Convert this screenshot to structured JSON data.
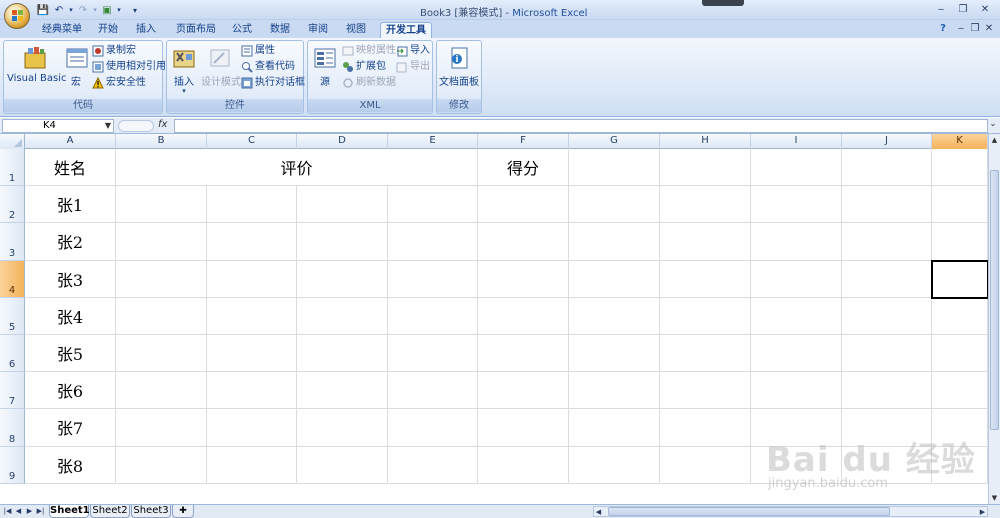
{
  "window": {
    "title_doc": "Book3 [兼容模式]",
    "title_sep": " - ",
    "title_app": "Microsoft Excel"
  },
  "tabs": [
    {
      "label": "经典菜单"
    },
    {
      "label": "开始"
    },
    {
      "label": "插入"
    },
    {
      "label": "页面布局"
    },
    {
      "label": "公式"
    },
    {
      "label": "数据"
    },
    {
      "label": "审阅"
    },
    {
      "label": "视图"
    },
    {
      "label": "开发工具",
      "active": true
    }
  ],
  "ribbon": {
    "code": {
      "label": "代码",
      "visual_basic": "Visual Basic",
      "macros": "宏",
      "record_macro": "录制宏",
      "relative_ref": "使用相对引用",
      "macro_security": "宏安全性"
    },
    "controls": {
      "label": "控件",
      "insert": "插入",
      "design_mode": "设计模式",
      "properties": "属性",
      "view_code": "查看代码",
      "run_dialog": "执行对话框"
    },
    "xml": {
      "label": "XML",
      "source": "源",
      "map_properties": "映射属性",
      "expansion_packs": "扩展包",
      "refresh_data": "刷新数据",
      "import": "导入",
      "export": "导出"
    },
    "modify": {
      "label": "修改",
      "document_panel": "文档面板"
    }
  },
  "formula_bar": {
    "name_box": "K4",
    "fx": "fx",
    "value": ""
  },
  "sheet": {
    "columns": [
      "A",
      "B",
      "C",
      "D",
      "E",
      "F",
      "G",
      "H",
      "I",
      "J",
      "K"
    ],
    "selected_column": "K",
    "rows": [
      "1",
      "2",
      "3",
      "4",
      "5",
      "6",
      "7",
      "8",
      "9"
    ],
    "selected_row": "4",
    "header": {
      "name": "姓名",
      "evaluation": "评价",
      "score": "得分"
    },
    "names": [
      "张1",
      "张2",
      "张3",
      "张4",
      "张5",
      "张6",
      "张7",
      "张8"
    ],
    "active_cell": "K4"
  },
  "sheet_tabs": [
    {
      "label": "Sheet1",
      "active": true
    },
    {
      "label": "Sheet2"
    },
    {
      "label": "Sheet3"
    }
  ],
  "watermark": {
    "brand": "Bai du 经验",
    "url": "jingyan.baidu.com"
  }
}
